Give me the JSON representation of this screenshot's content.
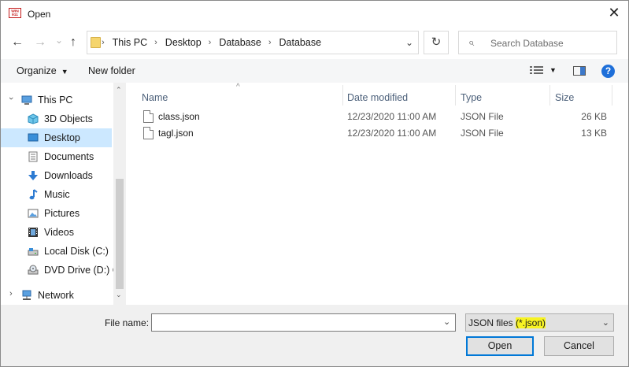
{
  "window": {
    "title": "Open",
    "app_icon_text": "WIN 911",
    "close_glyph": "✕"
  },
  "nav": {
    "back_glyph": "←",
    "forward_glyph": "→",
    "recent_glyph": "⌄",
    "up_glyph": "↑"
  },
  "address": {
    "crumbs": [
      "This PC",
      "Desktop",
      "Database",
      "Database"
    ],
    "separator": "›",
    "dropdown_glyph": "⌄",
    "refresh_glyph": "↻"
  },
  "search": {
    "placeholder": "Search Database",
    "icon_glyph": "⌕"
  },
  "toolbar": {
    "organize_label": "Organize",
    "organize_caret": "▼",
    "new_folder_label": "New folder",
    "view_caret": "▼",
    "help_glyph": "?"
  },
  "navpane": {
    "items": [
      {
        "label": "This PC",
        "icon": "computer-icon"
      },
      {
        "label": "3D Objects",
        "icon": "cube-icon"
      },
      {
        "label": "Desktop",
        "icon": "desktop-icon",
        "selected": true
      },
      {
        "label": "Documents",
        "icon": "document-icon"
      },
      {
        "label": "Downloads",
        "icon": "download-icon"
      },
      {
        "label": "Music",
        "icon": "music-icon"
      },
      {
        "label": "Pictures",
        "icon": "picture-icon"
      },
      {
        "label": "Videos",
        "icon": "video-icon"
      },
      {
        "label": "Local Disk (C:)",
        "icon": "disk-icon"
      },
      {
        "label": "DVD Drive (D:) C",
        "icon": "dvd-icon"
      },
      {
        "label": "Network",
        "icon": "network-icon"
      }
    ],
    "scroll_up_glyph": "⌃",
    "scroll_down_glyph": "⌄",
    "expand_glyph": "›"
  },
  "columns": {
    "name": "Name",
    "date": "Date modified",
    "type": "Type",
    "size": "Size",
    "sort_glyph": "^"
  },
  "files": [
    {
      "name": "class.json",
      "date": "12/23/2020 11:00 AM",
      "type": "JSON File",
      "size": "26 KB"
    },
    {
      "name": "tagl.json",
      "date": "12/23/2020 11:00 AM",
      "type": "JSON File",
      "size": "13 KB"
    }
  ],
  "bottom": {
    "file_name_label": "File name:",
    "file_name_value": "",
    "file_name_dd": "⌄",
    "filetype_prefix": "JSON files ",
    "filetype_highlight": "(*.json)",
    "filetype_dd": "⌄",
    "open_label": "Open",
    "cancel_label": "Cancel"
  },
  "colors": {
    "selection": "#cce8ff",
    "accent": "#0078d7",
    "highlight": "#f7f322"
  }
}
